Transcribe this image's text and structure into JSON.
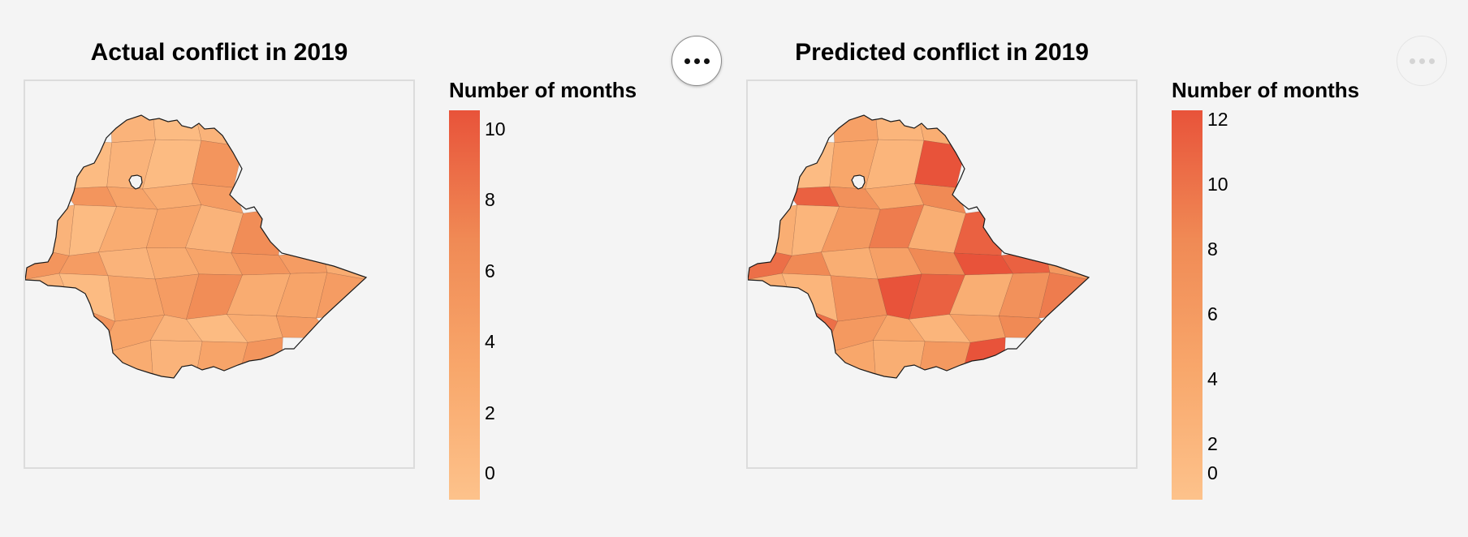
{
  "panels": [
    {
      "title": "Actual conflict in 2019",
      "legend_title": "Number of months",
      "legend_ticks": [
        "10",
        "8",
        "6",
        "4",
        "2",
        "0"
      ],
      "legend_max": 11,
      "region_values": [
        2,
        1,
        2,
        1,
        2,
        1,
        6,
        6,
        4,
        3,
        5,
        2,
        1,
        3,
        4,
        2,
        7,
        6,
        5,
        2,
        3,
        4,
        6,
        5,
        3,
        2,
        1,
        4,
        5,
        7,
        3,
        4,
        5,
        6,
        4,
        2,
        1,
        3,
        5,
        3,
        2,
        4,
        6,
        5,
        4,
        2,
        3,
        2,
        7,
        4,
        1,
        1
      ],
      "menu_label": "•••"
    },
    {
      "title": "Predicted conflict in 2019",
      "legend_title": "Number of months",
      "legend_ticks": [
        "12",
        "10",
        "8",
        "6",
        "4",
        "2",
        "0"
      ],
      "legend_max": 12,
      "region_values": [
        5,
        2,
        3,
        1,
        4,
        2,
        12,
        11,
        7,
        4,
        8,
        3,
        2,
        6,
        9,
        3,
        11,
        10,
        8,
        3,
        5,
        8,
        12,
        11,
        6,
        3,
        2,
        7,
        12,
        11,
        3,
        7,
        9,
        10,
        6,
        4,
        2,
        5,
        8,
        4,
        3,
        6,
        12,
        10,
        9,
        3,
        5,
        2,
        12,
        6,
        1,
        1
      ],
      "menu_label": "•••"
    }
  ],
  "colors": {
    "scale_high": "#e8533a",
    "scale_low": "#fdc28b",
    "border": "#1a1a1a",
    "background": "#f4f4f4"
  }
}
